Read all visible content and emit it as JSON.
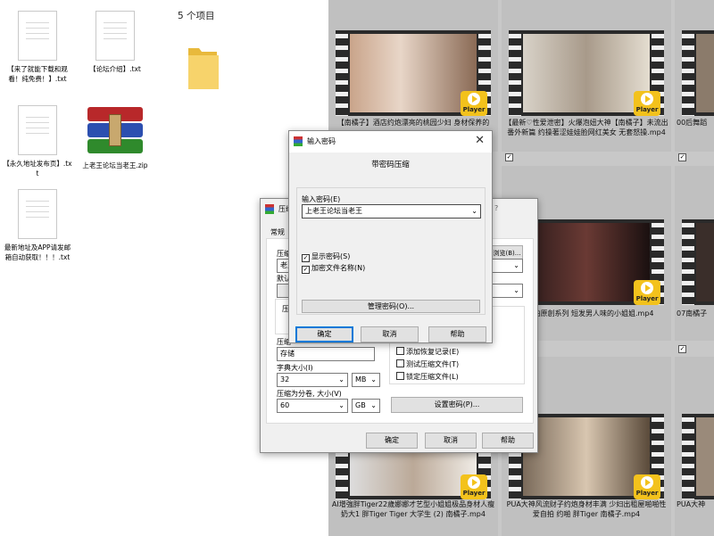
{
  "desktop_files": [
    {
      "name": "【来了就能下载和观看！纯免费！】.txt"
    },
    {
      "name": "【论坛介绍】.txt"
    },
    {
      "name": "【永久地址发布页】.txt"
    },
    {
      "name": "上老王论坛当老王.zip"
    },
    {
      "name": "最新地址及APP请发邮箱自动获取！！！.txt"
    }
  ],
  "explorer": {
    "item_count": "5 个项目"
  },
  "thumbnails": [
    {
      "caption": "【南橘子】酒店约炮漂亮的桃园少妇 身材保养的"
    },
    {
      "caption": "【最新♡性爱泄密】火爆泡妞大神【南橘子】未流出番外新篇 约操著涩娃娃脸网红美女 无套怒操.mp4"
    },
    {
      "caption": "00后舞蹈"
    },
    {
      "caption": "子拍拍原創系列 短发男人味的小姐姐.mp4"
    },
    {
      "caption": "07南橘子"
    },
    {
      "caption": "AI增強胖Tiger22歲娜娜才艺型小姐姐极品身材人瘦奶大1 胖Tiger Tiger 大学生 (2) 南橘子.mp4"
    },
    {
      "caption": "PUA大神风流财子约炮身材丰满 少妇出租屋啪啪性爱自拍 约啪 胖Tiger 南橘子.mp4"
    },
    {
      "caption": "PUA大神"
    }
  ],
  "player_label": "Player",
  "archive_dialog": {
    "title": "压缩",
    "help_q": "?",
    "tab_general": "常规",
    "fields": {
      "compress_label": "压缩",
      "name_value": "老王",
      "default_label": "默认",
      "format_label": "压缩",
      "method_label": "压缩",
      "method_value": "存储",
      "dict_label": "字典大小(I)",
      "dict_value": "32",
      "dict_unit": "MB",
      "volume_label": "压缩为分卷, 大小(V)",
      "volume_value": "60",
      "volume_unit": "GB"
    },
    "browse_button": "浏览(B)...",
    "options": [
      {
        "label": "添加恢复记录(E)"
      },
      {
        "label": "测试压缩文件(T)"
      },
      {
        "label": "锁定压缩文件(L)"
      }
    ],
    "set_password_button": "设置密码(P)...",
    "ok": "确定",
    "cancel": "取消",
    "help": "帮助"
  },
  "password_dialog": {
    "title": "输入密码",
    "heading": "带密码压缩",
    "password_label": "输入密码(E)",
    "password_value": "上老王论坛当老王",
    "show_password": "显示密码(S)",
    "encrypt_names": "加密文件名称(N)",
    "manage_button": "管理密码(O)...",
    "ok": "确定",
    "cancel": "取消",
    "help": "帮助"
  }
}
